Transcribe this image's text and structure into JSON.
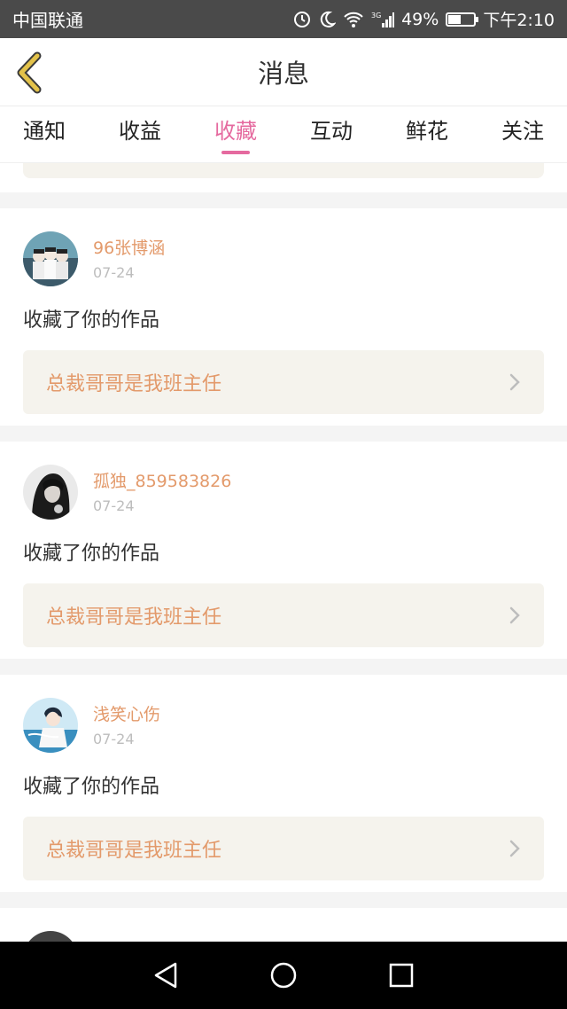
{
  "status_bar": {
    "carrier": "中国联通",
    "battery": "49%",
    "battery_level": 0.49,
    "time": "下午2:10",
    "network": "3G"
  },
  "header": {
    "title": "消息"
  },
  "tabs": [
    {
      "label": "通知"
    },
    {
      "label": "收益"
    },
    {
      "label": "收藏"
    },
    {
      "label": "互动"
    },
    {
      "label": "鲜花"
    },
    {
      "label": "关注"
    }
  ],
  "active_tab": "收藏",
  "messages": [
    {
      "username": "96张博涵",
      "date": "07-24",
      "action": "收藏了你的作品",
      "work_title": "总裁哥哥是我班主任"
    },
    {
      "username": "孤独_859583826",
      "date": "07-24",
      "action": "收藏了你的作品",
      "work_title": "总裁哥哥是我班主任"
    },
    {
      "username": "浅笑心伤",
      "date": "07-24",
      "action": "收藏了你的作品",
      "work_title": "总裁哥哥是我班主任"
    }
  ],
  "colors": {
    "accent": "#e56a9f",
    "username": "#e39a6b",
    "work_bg": "#f5f3ed",
    "back_icon": "#e3c24a"
  }
}
